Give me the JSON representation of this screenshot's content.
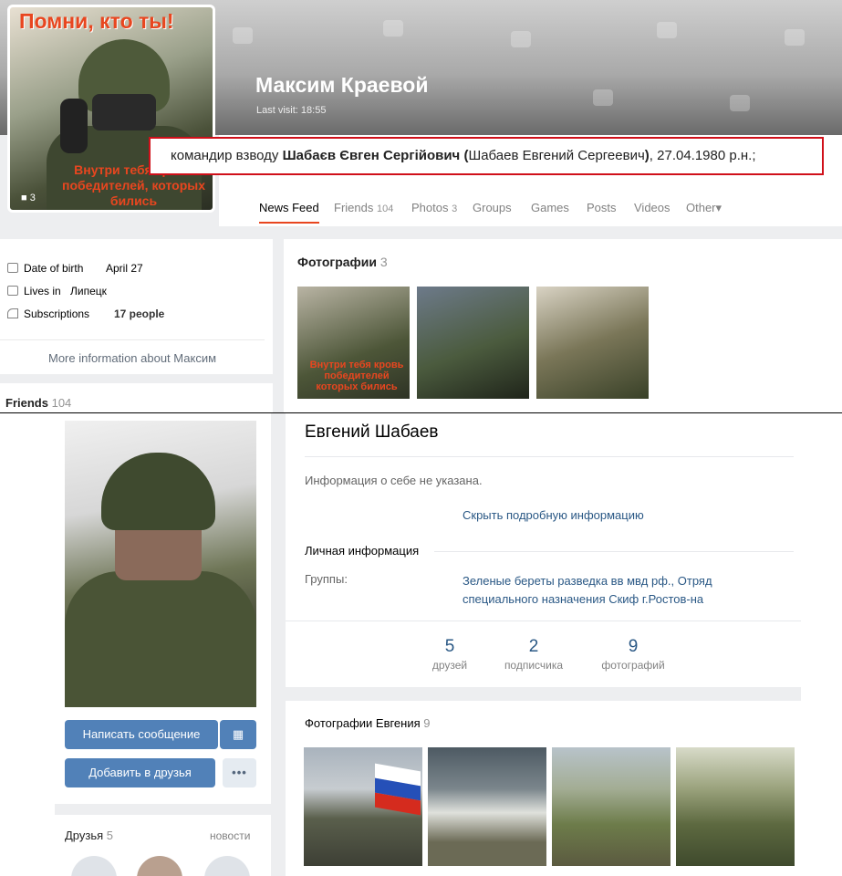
{
  "profile_top": {
    "avatar": {
      "title": "Помни, кто ты!",
      "caption": "Внутри тебя кровь победителей, которых бились",
      "counter": "3"
    },
    "name": "Максим Краевой",
    "last_visit": "Last visit: 18:55",
    "highlight": {
      "prefix": "командир взводу ",
      "bold_name": "Шабаєв Євген Сергійович",
      "open_paren": " (",
      "russian_name": "Шабаев Евгений Сергеевич",
      "close_paren": ")",
      "suffix": ", 27.04.1980 р.н.;"
    },
    "tabs": [
      {
        "label": "News Feed",
        "count": ""
      },
      {
        "label": "Friends",
        "count": "104"
      },
      {
        "label": "Photos",
        "count": "3"
      },
      {
        "label": "Groups",
        "count": ""
      },
      {
        "label": "Games",
        "count": ""
      },
      {
        "label": "Posts",
        "count": ""
      },
      {
        "label": "Videos",
        "count": ""
      },
      {
        "label": "Other",
        "count": ""
      }
    ],
    "info": {
      "birth_label": "Date of birth",
      "birth_value": "April 27",
      "lives_label": "Lives in",
      "lives_value": "Липецк",
      "subs_label": "Subscriptions",
      "subs_value": "17 people",
      "more": "More information about Максим"
    },
    "friends": {
      "label": "Friends",
      "count": "104"
    },
    "photos": {
      "label": "Фотографии",
      "count": "3",
      "thumb_caption": "Внутри тебя кровь победителей которых бились"
    }
  },
  "profile_bottom": {
    "name": "Евгений Шабаев",
    "about": "Информация о себе не указана.",
    "hide_link": "Скрыть подробную информацию",
    "personal_header": "Личная информация",
    "groups_label": "Группы:",
    "groups_value": "Зеленые береты разведка вв мвд рф., Отряд специального назначения Скиф г.Ростов-на",
    "counters": [
      {
        "num": "5",
        "label": "друзей"
      },
      {
        "num": "2",
        "label": "подписчика"
      },
      {
        "num": "9",
        "label": "фотографий"
      }
    ],
    "buttons": {
      "message": "Написать сообщение",
      "add_friend": "Добавить в друзья",
      "more": "•••"
    },
    "friends": {
      "label": "Друзья",
      "count": "5",
      "news": "новости"
    },
    "photos": {
      "label": "Фотографии Евгения",
      "count": "9"
    }
  },
  "colors": {
    "accent_orange": "#e8461f",
    "highlight_border": "#d0101a",
    "vk_blue": "#5181b8",
    "link_blue": "#2a5885"
  }
}
